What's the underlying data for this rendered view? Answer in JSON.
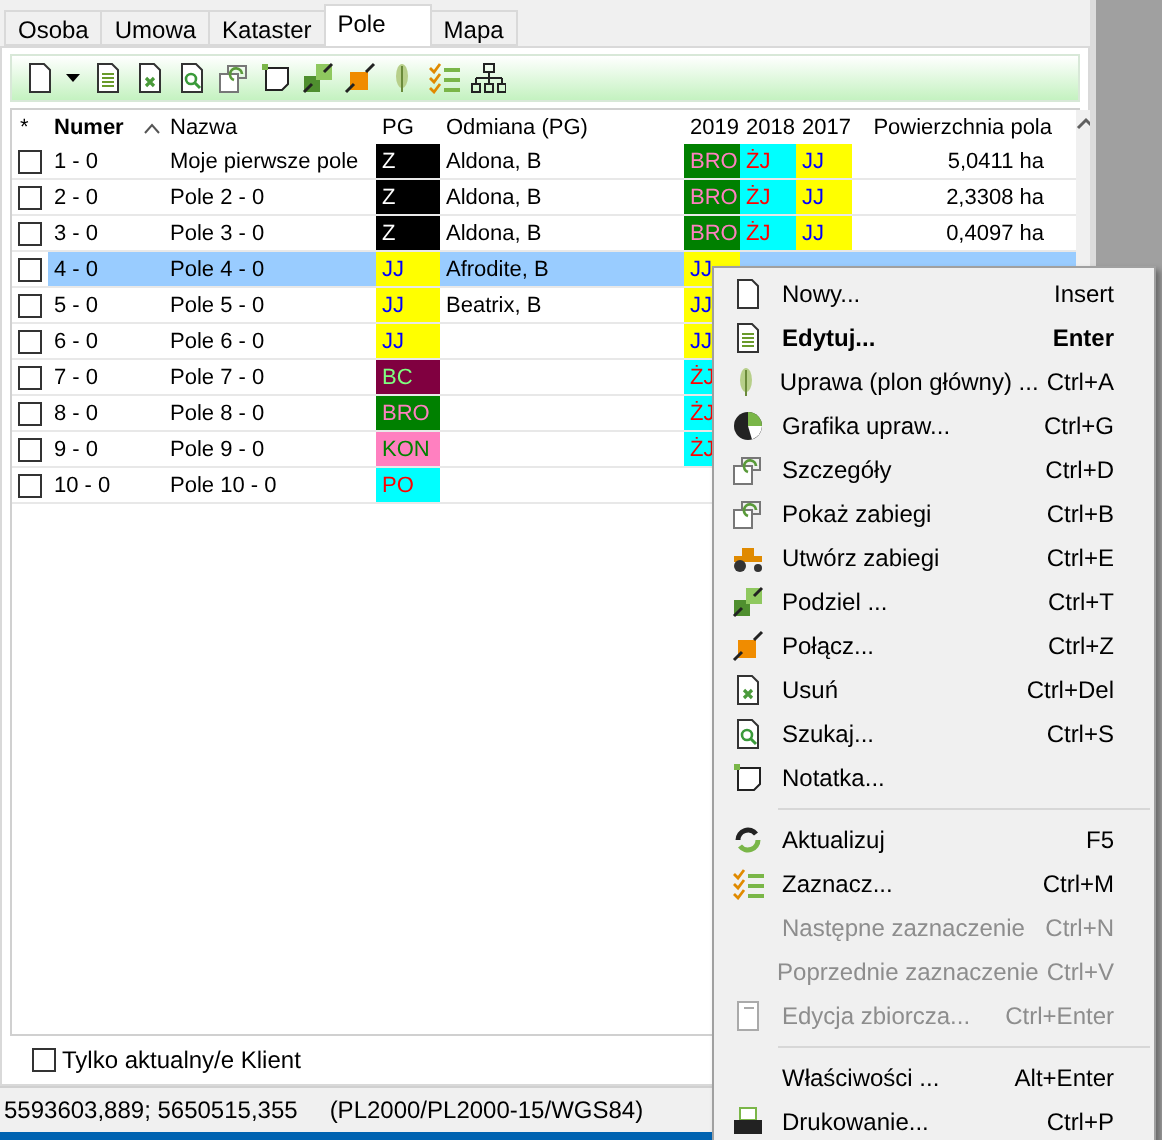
{
  "tabs": [
    {
      "label": "Osoba",
      "selected": false
    },
    {
      "label": "Umowa",
      "selected": false
    },
    {
      "label": "Kataster",
      "selected": false
    },
    {
      "label": "Pole",
      "selected": true
    },
    {
      "label": "Mapa",
      "selected": false
    }
  ],
  "table": {
    "columns": [
      {
        "label": "*",
        "sorted": false
      },
      {
        "label": "Numer",
        "sorted": true
      },
      {
        "label": "Nazwa",
        "sorted": false
      },
      {
        "label": "PG",
        "sorted": false
      },
      {
        "label": "Odmiana (PG)",
        "sorted": false
      },
      {
        "label": "2019",
        "sorted": false
      },
      {
        "label": "2018",
        "sorted": false
      },
      {
        "label": "2017",
        "sorted": false
      },
      {
        "label": "Powierzchnia pola",
        "sorted": false
      }
    ],
    "rows": [
      {
        "checked": false,
        "selected": false,
        "number": "1 - 0",
        "name": "Moje pierwsze pole",
        "pg": {
          "text": "Z",
          "color": "#000000"
        },
        "variety": "Aldona, B",
        "years": [
          {
            "text": "BRO",
            "color": "#008000"
          },
          {
            "text": "ŻJ",
            "color": "#00ffff"
          },
          {
            "text": "JJ",
            "color": "#ffff00"
          }
        ],
        "area": "5,0411 ha"
      },
      {
        "checked": false,
        "selected": false,
        "number": "2 - 0",
        "name": "Pole 2 - 0",
        "pg": {
          "text": "Z",
          "color": "#000000"
        },
        "variety": "Aldona, B",
        "years": [
          {
            "text": "BRO",
            "color": "#008000"
          },
          {
            "text": "ŻJ",
            "color": "#00ffff"
          },
          {
            "text": "JJ",
            "color": "#ffff00"
          }
        ],
        "area": "2,3308 ha"
      },
      {
        "checked": false,
        "selected": false,
        "number": "3 - 0",
        "name": "Pole 3 - 0",
        "pg": {
          "text": "Z",
          "color": "#000000"
        },
        "variety": "Aldona, B",
        "years": [
          {
            "text": "BRO",
            "color": "#008000"
          },
          {
            "text": "ŻJ",
            "color": "#00ffff"
          },
          {
            "text": "JJ",
            "color": "#ffff00"
          }
        ],
        "area": "0,4097 ha"
      },
      {
        "checked": false,
        "selected": true,
        "number": "4 - 0",
        "name": "Pole 4 - 0",
        "pg": {
          "text": "JJ",
          "color": "#ffff00"
        },
        "variety": "Afrodite, B",
        "years": [
          {
            "text": "JJ",
            "color": "#ffff00"
          }
        ]
      },
      {
        "checked": false,
        "selected": false,
        "number": "5 - 0",
        "name": "Pole 5 - 0",
        "pg": {
          "text": "JJ",
          "color": "#ffff00"
        },
        "variety": "Beatrix, B",
        "years": [
          {
            "text": "JJ",
            "color": "#ffff00"
          }
        ]
      },
      {
        "checked": false,
        "selected": false,
        "number": "6 - 0",
        "name": "Pole 6 - 0",
        "pg": {
          "text": "JJ",
          "color": "#ffff00"
        },
        "years": [
          {
            "text": "JJ",
            "color": "#ffff00"
          }
        ]
      },
      {
        "checked": false,
        "selected": false,
        "number": "7 - 0",
        "name": "Pole 7 - 0",
        "pg": {
          "text": "BC",
          "color": "#800040"
        },
        "years": [
          {
            "text": "ŻJ",
            "color": "#00ffff"
          }
        ]
      },
      {
        "checked": false,
        "selected": false,
        "number": "8 - 0",
        "name": "Pole 8 - 0",
        "pg": {
          "text": "BRO",
          "color": "#008000"
        },
        "years": [
          {
            "text": "ŻJ",
            "color": "#00ffff"
          }
        ]
      },
      {
        "checked": false,
        "selected": false,
        "number": "9 - 0",
        "name": "Pole 9 - 0",
        "pg": {
          "text": "KON",
          "color": "#ff80c0"
        },
        "years": [
          {
            "text": "ŻJ",
            "color": "#00ffff"
          }
        ]
      },
      {
        "checked": false,
        "selected": false,
        "number": "10 - 0",
        "name": "Pole 10 - 0",
        "pg": {
          "text": "PO",
          "color": "#00ffff"
        },
        "years": []
      }
    ]
  },
  "filter": {
    "label": "Tylko aktualny/e Klient",
    "checked": false
  },
  "status_bar": {
    "coordinates": "5593603,889; 5650515,355",
    "projection": "(PL2000/PL2000-15/WGS84)"
  },
  "context_menu": {
    "items": [
      {
        "kind": "item",
        "label": "Nowy...",
        "shortcut": "Insert",
        "bold": false,
        "disabled": false
      },
      {
        "kind": "item",
        "label": "Edytuj...",
        "shortcut": "Enter",
        "bold": true,
        "disabled": false
      },
      {
        "kind": "item",
        "label": "Uprawa (plon główny) ...",
        "shortcut": "Ctrl+A",
        "bold": false,
        "disabled": false
      },
      {
        "kind": "item",
        "label": "Grafika upraw...",
        "shortcut": "Ctrl+G",
        "bold": false,
        "disabled": false
      },
      {
        "kind": "item",
        "label": "Szczegóły",
        "shortcut": "Ctrl+D",
        "bold": false,
        "disabled": false
      },
      {
        "kind": "item",
        "label": "Pokaż zabiegi",
        "shortcut": "Ctrl+B",
        "bold": false,
        "disabled": false
      },
      {
        "kind": "item",
        "label": "Utwórz zabiegi",
        "shortcut": "Ctrl+E",
        "bold": false,
        "disabled": false
      },
      {
        "kind": "item",
        "label": "Podziel ...",
        "shortcut": "Ctrl+T",
        "bold": false,
        "disabled": false
      },
      {
        "kind": "item",
        "label": "Połącz...",
        "shortcut": "Ctrl+Z",
        "bold": false,
        "disabled": false
      },
      {
        "kind": "item",
        "label": "Usuń",
        "shortcut": "Ctrl+Del",
        "bold": false,
        "disabled": false
      },
      {
        "kind": "item",
        "label": "Szukaj...",
        "shortcut": "Ctrl+S",
        "bold": false,
        "disabled": false
      },
      {
        "kind": "item",
        "label": "Notatka...",
        "bold": false,
        "disabled": false
      },
      {
        "kind": "separator"
      },
      {
        "kind": "item",
        "label": "Aktualizuj",
        "shortcut": "F5",
        "bold": false,
        "disabled": false
      },
      {
        "kind": "item",
        "label": "Zaznacz...",
        "shortcut": "Ctrl+M",
        "bold": false,
        "disabled": false
      },
      {
        "kind": "item",
        "label": "Następne zaznaczenie",
        "shortcut": "Ctrl+N",
        "bold": false,
        "disabled": true
      },
      {
        "kind": "item",
        "label": "Poprzednie zaznaczenie",
        "shortcut": "Ctrl+V",
        "bold": false,
        "disabled": true
      },
      {
        "kind": "item",
        "label": "Edycja zbiorcza...",
        "shortcut": "Ctrl+Enter",
        "bold": false,
        "disabled": true
      },
      {
        "kind": "separator"
      },
      {
        "kind": "item",
        "label": "Właściwości ...",
        "shortcut": "Alt+Enter",
        "bold": false,
        "disabled": false
      },
      {
        "kind": "item",
        "label": "Drukowanie...",
        "shortcut": "Ctrl+P",
        "bold": false,
        "disabled": false
      }
    ]
  }
}
